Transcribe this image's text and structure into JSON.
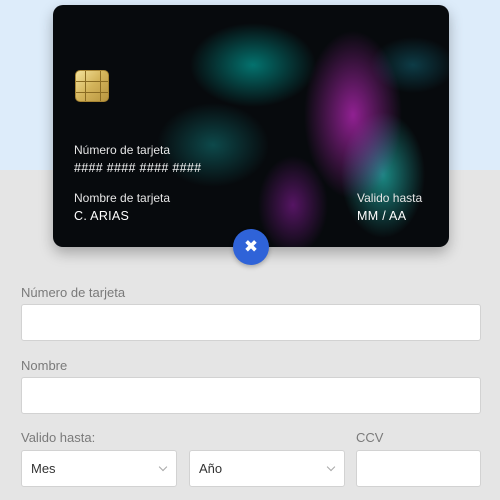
{
  "card": {
    "number_label": "Número de tarjeta",
    "number_value": "#### #### #### ####",
    "name_label": "Nombre de tarjeta",
    "name_value": "C. ARIAS",
    "expiry_label": "Valido hasta",
    "expiry_value": "MM / AA"
  },
  "close_button": {
    "glyph": "✖",
    "icon": "close-icon",
    "color": "#2f63d8"
  },
  "form": {
    "number_label": "Número de tarjeta",
    "number_value": "",
    "name_label": "Nombre",
    "name_value": "",
    "expiry_label": "Valido hasta:",
    "month_selected": "Mes",
    "year_selected": "Año",
    "ccv_label": "CCV",
    "ccv_value": ""
  },
  "colors": {
    "top_background": "#ddecfa",
    "page_background": "#e5e5e5"
  }
}
